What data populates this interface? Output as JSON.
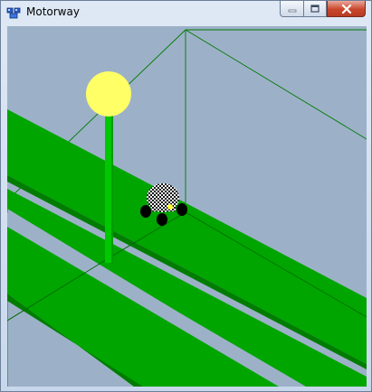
{
  "window": {
    "title": "Motorway"
  },
  "controls": {
    "minimize_icon": "minimize-icon",
    "maximize_icon": "maximize-icon",
    "close_icon": "close-icon"
  },
  "scene": {
    "colors": {
      "sky": "#9cb1c8",
      "road": "#00a500",
      "grid_lines": "#007a00",
      "lamp_post": "#00c800",
      "lamp_light": "#ffff66",
      "wheels": "#000000"
    }
  }
}
